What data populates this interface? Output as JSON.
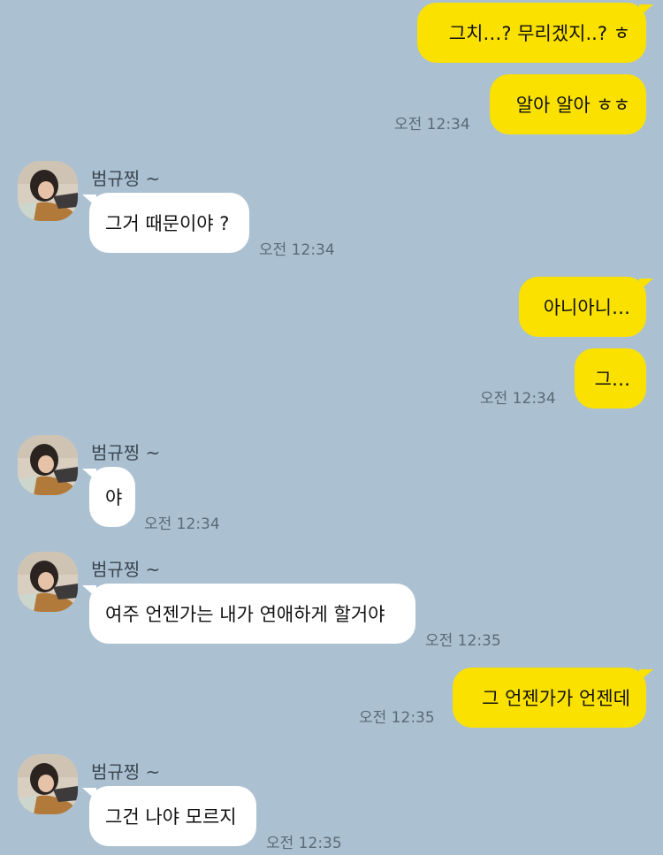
{
  "sender_name": "범규찡 ~",
  "messages": [
    {
      "id": "m1",
      "text": "그치…? 무리겠지..? ㅎ"
    },
    {
      "id": "m2",
      "text": "알아 알아 ㅎㅎ",
      "time": "오전 12:34"
    },
    {
      "id": "m3",
      "text": "그거 때문이야 ?",
      "time": "오전 12:34"
    },
    {
      "id": "m4",
      "text": "아니아니…"
    },
    {
      "id": "m5",
      "text": "그…",
      "time": "오전 12:34"
    },
    {
      "id": "m6",
      "text": "야",
      "time": "오전 12:34"
    },
    {
      "id": "m7",
      "text": "여주 언젠가는 내가 연애하게 할거야",
      "time": "오전 12:35"
    },
    {
      "id": "m8",
      "text": "그 언젠가가 언젠데",
      "time": "오전 12:35"
    },
    {
      "id": "m9",
      "text": "그건 나야 모르지",
      "time": "오전 12:35"
    }
  ],
  "colors": {
    "background": "#abc1d1",
    "outgoing_bubble": "#fae100",
    "incoming_bubble": "#ffffff"
  },
  "icons": {
    "avatar": "profile-photo"
  }
}
